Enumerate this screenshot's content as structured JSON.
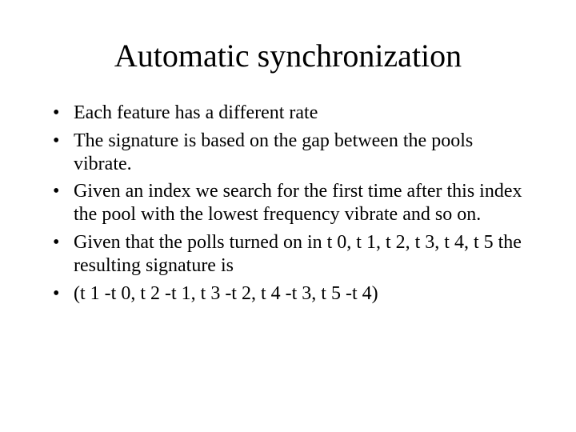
{
  "slide": {
    "title": "Automatic synchronization",
    "bullets": [
      "Each feature has a different rate",
      "The signature is based on the gap between the pools vibrate.",
      "Given an index we search for the first time after this index the pool with the lowest frequency vibrate and so on.",
      "Given that the polls turned on in t 0, t 1, t 2, t 3, t 4, t 5 the resulting signature is",
      "(t 1 -t 0, t 2 -t 1, t 3 -t 2, t 4 -t 3, t 5 -t 4)"
    ]
  }
}
